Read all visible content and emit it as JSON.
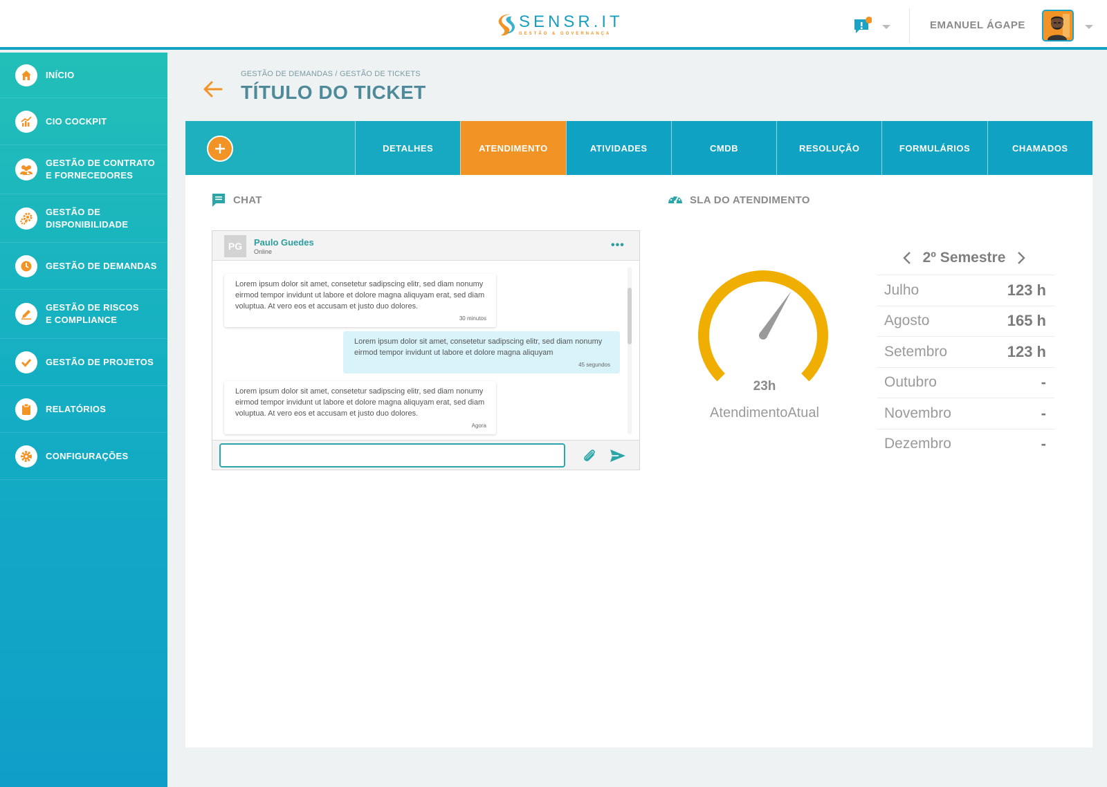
{
  "brand": {
    "name": "SENSR.IT",
    "tagline": "GESTÃO & GOVERNANÇA",
    "primary": "#1aa3c6",
    "accent": "#f29325",
    "teal": "#22bfb8"
  },
  "header": {
    "username": "EMANUEL ÁGAPE",
    "notification_icon": "chat-alert-icon"
  },
  "sidebar": {
    "items": [
      {
        "label": "INÍCIO",
        "icon": "home-icon"
      },
      {
        "label": "CIO COCKPIT",
        "icon": "chart-icon"
      },
      {
        "label": "GESTÃO DE CONTRATO\nE FORNECEDORES",
        "icon": "people-icon"
      },
      {
        "label": "GESTÃO DE\nDISPONIBILIDADE",
        "icon": "gears-icon"
      },
      {
        "label": "GESTÃO DE DEMANDAS",
        "icon": "clock-icon"
      },
      {
        "label": "GESTÃO DE RISCOS\nE COMPLIANCE",
        "icon": "pencil-icon"
      },
      {
        "label": "GESTÃO DE PROJETOS",
        "icon": "check-icon"
      },
      {
        "label": "RELATÓRIOS",
        "icon": "clipboard-icon"
      },
      {
        "label": "CONFIGURAÇÕES",
        "icon": "gear-icon"
      }
    ]
  },
  "page": {
    "breadcrumb": "GESTÃO DE DEMANDAS / GESTÃO DE TICKETS",
    "title": "TÍTULO DO TICKET"
  },
  "tabs": [
    {
      "label": "DETALHES"
    },
    {
      "label": "ATENDIMENTO",
      "active": true
    },
    {
      "label": "ATIVIDADES"
    },
    {
      "label": "CMDB"
    },
    {
      "label": "RESOLUÇÃO"
    },
    {
      "label": "FORMULÁRIOS"
    },
    {
      "label": "CHAMADOS"
    }
  ],
  "chat": {
    "section_title": "CHAT",
    "contact": {
      "initials": "PG",
      "name": "Paulo Guedes",
      "status": "Online"
    },
    "messages": [
      {
        "direction": "in",
        "text": "Lorem ipsum dolor sit amet, consetetur sadipscing elitr, sed diam nonumy eirmod tempor invidunt ut labore et dolore magna aliquyam erat, sed diam voluptua. At vero eos et accusam et justo duo dolores.",
        "time": "30 minutos"
      },
      {
        "direction": "out",
        "text": "Lorem ipsum dolor sit amet, consetetur sadipscing elitr, sed diam nonumy eirmod tempor invidunt ut labore et dolore magna aliquyam",
        "time": "45 segundos"
      },
      {
        "direction": "in",
        "text": "Lorem ipsum dolor sit amet, consetetur sadipscing elitr, sed diam nonumy eirmod tempor invidunt ut labore et dolore magna aliquyam erat, sed diam voluptua. At vero eos et accusam et justo duo dolores.",
        "time": "Agora"
      }
    ],
    "input_value": "",
    "input_placeholder": ""
  },
  "sla": {
    "section_title": "SLA DO ATENDIMENTO",
    "gauge": {
      "value": "23h",
      "label": "AtendimentoAtual",
      "needle_fraction": 0.62,
      "color": "#f0ae00"
    },
    "semester": "2º Semestre",
    "months": [
      {
        "name": "Julho",
        "value": "123 h"
      },
      {
        "name": "Agosto",
        "value": "165 h"
      },
      {
        "name": "Setembro",
        "value": "123 h"
      },
      {
        "name": "Outubro",
        "value": "-"
      },
      {
        "name": "Novembro",
        "value": "-"
      },
      {
        "name": "Dezembro",
        "value": "-"
      }
    ]
  }
}
